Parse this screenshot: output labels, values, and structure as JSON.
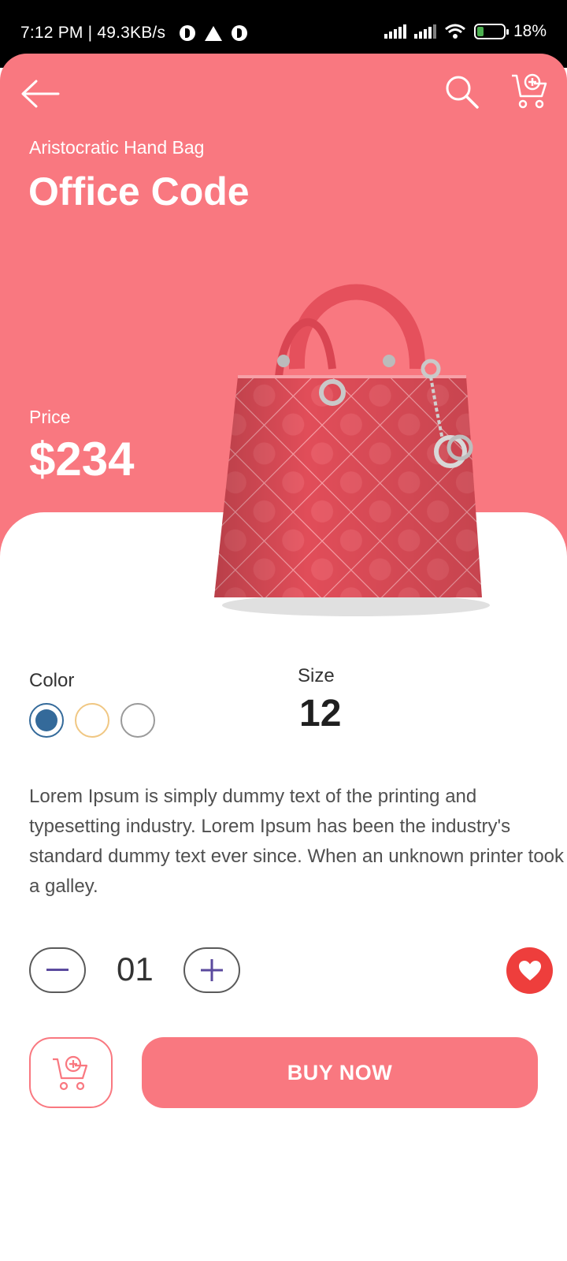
{
  "status_bar": {
    "left_text": "7:12 PM | 49.3KB/s",
    "battery_text": "18%"
  },
  "header": {
    "back_icon": "arrow-left-icon",
    "search_icon": "search-icon",
    "cart_icon": "cart-add-icon"
  },
  "product": {
    "subtitle": "Aristocratic Hand Bag",
    "title": "Office Code",
    "price_label": "Price",
    "price": "$234",
    "color_label": "Color",
    "colors": [
      "#346a9a",
      "#f0c783",
      "#9a9a9a"
    ],
    "selected_color": "#346a9a",
    "size_label": "Size",
    "size": "12",
    "description": "Lorem Ipsum is simply dummy text of the printing and typesetting industry. Lorem Ipsum has been the industry's standard dummy text ever since. When an unknown printer took a galley."
  },
  "quantity": {
    "value": "01"
  },
  "actions": {
    "buy_label": "BUY NOW"
  },
  "theme": {
    "accent": "#f97880",
    "favorite": "#ee3e3c",
    "stepper_icon": "#5b4a9e"
  }
}
